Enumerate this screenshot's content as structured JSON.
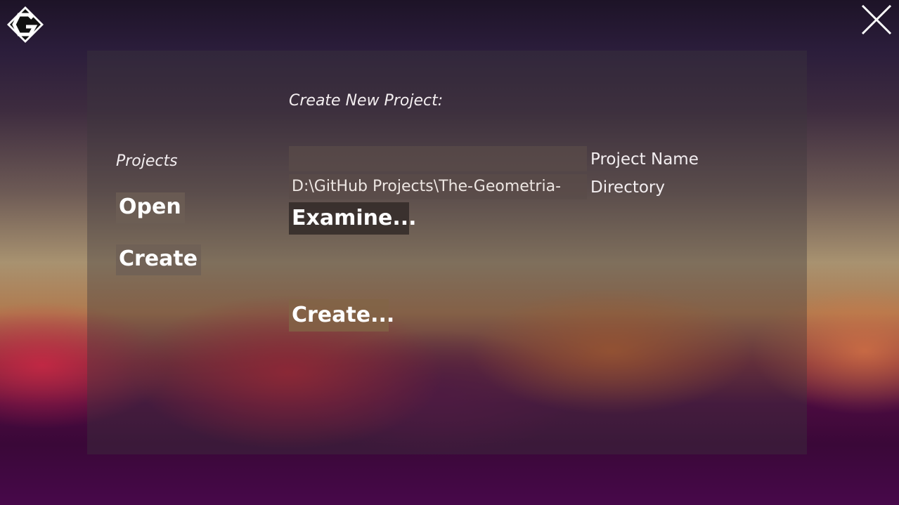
{
  "window": {
    "logo_icon": "g-diamond-logo-icon",
    "close_icon": "close-icon"
  },
  "sidebar": {
    "title": "Projects",
    "items": [
      {
        "label": "Open"
      },
      {
        "label": "Create"
      }
    ]
  },
  "main": {
    "heading": "Create New Project:",
    "fields": [
      {
        "label": "Project Name",
        "value": "",
        "placeholder": ""
      },
      {
        "label": "Directory",
        "value": "D:\\GitHub Projects\\The-Geometria-"
      }
    ],
    "examine_label": "Examine...",
    "create_label": "Create..."
  }
}
